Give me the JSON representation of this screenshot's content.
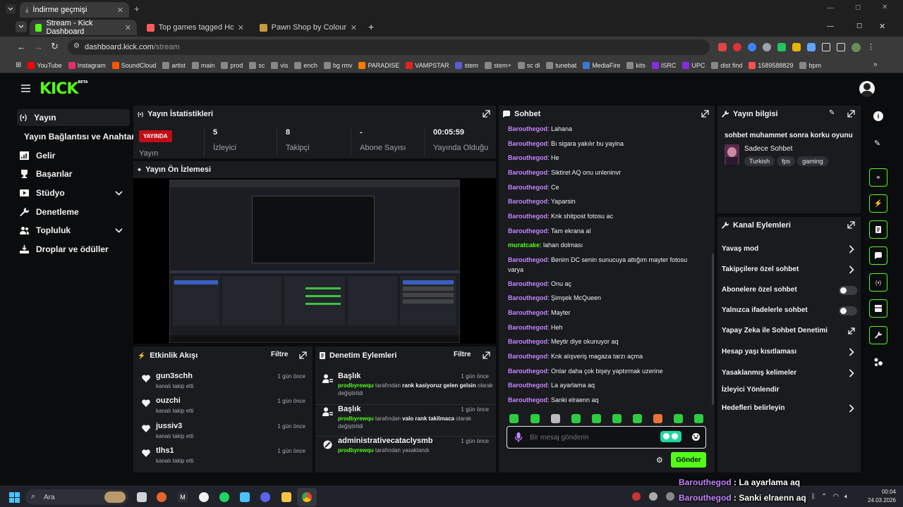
{
  "browser": {
    "top_tab": "İndirme geçmişi",
    "tabs": [
      {
        "label": "Stream - Kick Dashboard",
        "active": true
      },
      {
        "label": "Top games tagged Horror - itch",
        "active": false
      },
      {
        "label": "Pawn Shop by Colourplay Game",
        "active": false
      }
    ],
    "url_host": "dashboard.kick.com",
    "url_path": "/stream",
    "bookmarks": [
      "YouTube",
      "Instagram",
      "SoundCloud",
      "artist",
      "main",
      "prod",
      "sc",
      "vis",
      "ench",
      "bg rmv",
      "PARADISE",
      "VAMPSTAR",
      "stem",
      "stem+",
      "sc dl",
      "tunebat",
      "MediaFire",
      "kits",
      "ISRC",
      "UPC",
      "dist find",
      "1589588829",
      "bpm"
    ],
    "bookmark_colors": [
      "#ff0000",
      "#e1306c",
      "#ff5500",
      "#888888",
      "#888888",
      "#888888",
      "#888888",
      "#888888",
      "#888888",
      "#888888",
      "#ff7a00",
      "#e02424",
      "#5b5bd6",
      "#888888",
      "#888888",
      "#888888",
      "#3a7bd5",
      "#888888",
      "#8a2be2",
      "#8a2be2",
      "#888888",
      "#ff5050",
      "#888888"
    ]
  },
  "kick": {
    "logo": "KICK",
    "logo_badge": "BETA",
    "nav": [
      {
        "label": "Yayın",
        "icon": "broadcast-icon",
        "selected": true
      },
      {
        "label": "Yayın Bağlantısı ve Anahtarı",
        "icon": "",
        "selected": false
      },
      {
        "label": "Gelir",
        "icon": "revenue-icon",
        "selected": false
      },
      {
        "label": "Başarılar",
        "icon": "trophy-icon",
        "selected": false
      },
      {
        "label": "Stüdyo",
        "icon": "studio-icon",
        "selected": false,
        "chevron": true
      },
      {
        "label": "Denetleme",
        "icon": "wrench-icon",
        "selected": false
      },
      {
        "label": "Topluluk",
        "icon": "community-icon",
        "selected": false,
        "chevron": true
      },
      {
        "label": "Droplar ve ödüller",
        "icon": "drops-icon",
        "selected": false
      }
    ],
    "stats": {
      "title": "Yayın İstatistikleri",
      "live_badge": "YAYINDA",
      "status_label": "Yayın",
      "items": [
        {
          "value": "5",
          "label": "İzleyici"
        },
        {
          "value": "8",
          "label": "Takipçi"
        },
        {
          "value": "-",
          "label": "Abone Sayısı"
        },
        {
          "value": "00:05:59",
          "label": "Yayında Olduğu"
        }
      ]
    },
    "preview": {
      "title": "Yayın Ön İzlemesi"
    },
    "activity": {
      "title": "Etkinlik Akışı",
      "filter": "Filtre",
      "items": [
        {
          "user": "gun3schh",
          "action": "kanalı takip etti",
          "ago": "1 gün önce"
        },
        {
          "user": "ouzchi",
          "action": "kanalı takip etti",
          "ago": "1 gün önce"
        },
        {
          "user": "jussiv3",
          "action": "kanalı takip etti",
          "ago": "1 gün önce"
        },
        {
          "user": "tlhs1",
          "action": "kanalı takip etti",
          "ago": "1 gün önce"
        }
      ]
    },
    "mod": {
      "title": "Denetim Eylemleri",
      "filter": "Filtre",
      "items": [
        {
          "title": "Başlık",
          "ago": "1 gün önce",
          "actor": "prodbyrewqu",
          "mid": "tarafından",
          "value": "rank kasiyoruz gelen gelsin",
          "tail": "olarak değiştirildi"
        },
        {
          "title": "Başlık",
          "ago": "1 gün önce",
          "actor": "prodbyrewqu",
          "mid": "tarafından",
          "value": "valo rank takilmaca",
          "tail": "olarak değiştirildi"
        },
        {
          "title": "administrativecataclysmb",
          "ago": "1 gün önce",
          "actor": "prodbyrewqu",
          "mid": "tarafından yasaklandı",
          "value": "",
          "tail": ""
        }
      ]
    },
    "chat": {
      "title": "Sohbet",
      "messages": [
        {
          "user": "Barouthegod",
          "text": "Lahana"
        },
        {
          "user": "Barouthegod",
          "text": "Bı sigara yakılır bu yayina"
        },
        {
          "user": "Barouthegod",
          "text": "He"
        },
        {
          "user": "Barouthegod",
          "text": "Siktiret AQ onu unleninvr"
        },
        {
          "user": "Barouthegod",
          "text": "Ce"
        },
        {
          "user": "Barouthegod",
          "text": "Yaparsin"
        },
        {
          "user": "Barouthegod",
          "text": "Knk shitpost fotosu ac"
        },
        {
          "user": "Barouthegod",
          "text": "Tam ekrana al"
        },
        {
          "user": "muratcake",
          "text": "lahan dolması"
        },
        {
          "user": "Barouthegod",
          "text": "Benim DC senin sunucuya attığım mayter fotosu varya"
        },
        {
          "user": "Barouthegod",
          "text": "Onu aç"
        },
        {
          "user": "Barouthegod",
          "text": "Şimşek McQueen"
        },
        {
          "user": "Barouthegod",
          "text": "Mayter"
        },
        {
          "user": "Barouthegod",
          "text": "Heh"
        },
        {
          "user": "Barouthegod",
          "text": "Meytir diye okunuyor aq"
        },
        {
          "user": "Barouthegod",
          "text": "Knk alışveriş magaza tarzı açma"
        },
        {
          "user": "Barouthegod",
          "text": "Onlar daha çok bişey yaptırmak uzerine"
        },
        {
          "user": "Barouthegod",
          "text": "La ayarlama aq"
        },
        {
          "user": "Barouthegod",
          "text": "Sanki elraenn aq"
        }
      ],
      "placeholder": "Bir mesaj gönderin",
      "send": "Gönder"
    },
    "info": {
      "title": "Yayın bilgisi",
      "stream_title": "sohbet muhammet sonra korku oyunu",
      "category": "Sadece Sohbet",
      "tags": [
        "Turkish",
        "fps",
        "gaming"
      ]
    },
    "channel_actions": {
      "title": "Kanal Eylemleri",
      "items": [
        {
          "label": "Yavaş mod",
          "control": "chevron"
        },
        {
          "label": "Takipçilere özel sohbet",
          "control": "chevron"
        },
        {
          "label": "Abonelere özel sohbet",
          "control": "toggle"
        },
        {
          "label": "Yalnızca ifadelerle sohbet",
          "control": "toggle"
        },
        {
          "label": "Yapay Zeka ile Sohbet Denetimi",
          "control": "external"
        },
        {
          "label": "Hesap yaşı kısıtlaması",
          "control": "chevron"
        },
        {
          "label": "Yasaklanmış kelimeler",
          "control": "chevron"
        },
        {
          "label": "İzleyici Yönlendir",
          "control": "none"
        },
        {
          "label": "Hedefleri belirleyin",
          "control": "chevron"
        }
      ]
    }
  },
  "taskbar": {
    "search": "Ara",
    "time": "00:04",
    "date": "24.03.2026"
  },
  "overlay": [
    {
      "user": "Barouthegod",
      "sep": ":",
      "text": "La ayarlama aq"
    },
    {
      "user": "Barouthegod",
      "sep": ":",
      "text": "Sanki elraenn aq"
    }
  ],
  "colors": {
    "accent": "#53fc18",
    "chat_name": "#c785ff",
    "live": "#c10d16"
  }
}
